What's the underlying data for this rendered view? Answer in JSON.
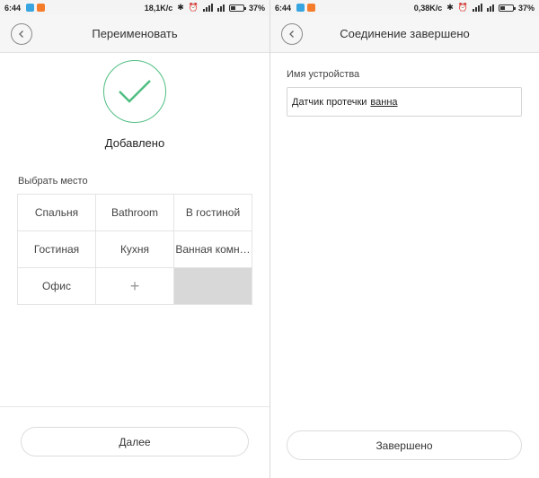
{
  "left": {
    "status": {
      "time": "6:44",
      "speed": "18,1K/c",
      "battery": "37%",
      "battery_level": 0.37
    },
    "title": "Переименовать",
    "added_label": "Добавлено",
    "section_label": "Выбрать место",
    "locations": [
      "Спальня",
      "Bathroom",
      "В гостиной",
      "Гостиная",
      "Кухня",
      "Ванная комн…",
      "Офис",
      "+",
      ""
    ],
    "next_button": "Далее"
  },
  "right": {
    "status": {
      "time": "6:44",
      "speed": "0,38K/c",
      "battery": "37%",
      "battery_level": 0.37
    },
    "title": "Соединение завершено",
    "field_label": "Имя устройства",
    "device_name_prefix": "Датчик протечки",
    "device_name_word": "ванна",
    "done_button": "Завершено"
  },
  "colors": {
    "accent": "#4fbe82",
    "empty_cell": "#d8d8d8"
  },
  "icons": [
    "back-arrow-icon",
    "checkmark-icon",
    "bluetooth-icon",
    "alarm-icon",
    "wifi-icon",
    "signal-icon",
    "battery-icon",
    "plus-icon"
  ]
}
